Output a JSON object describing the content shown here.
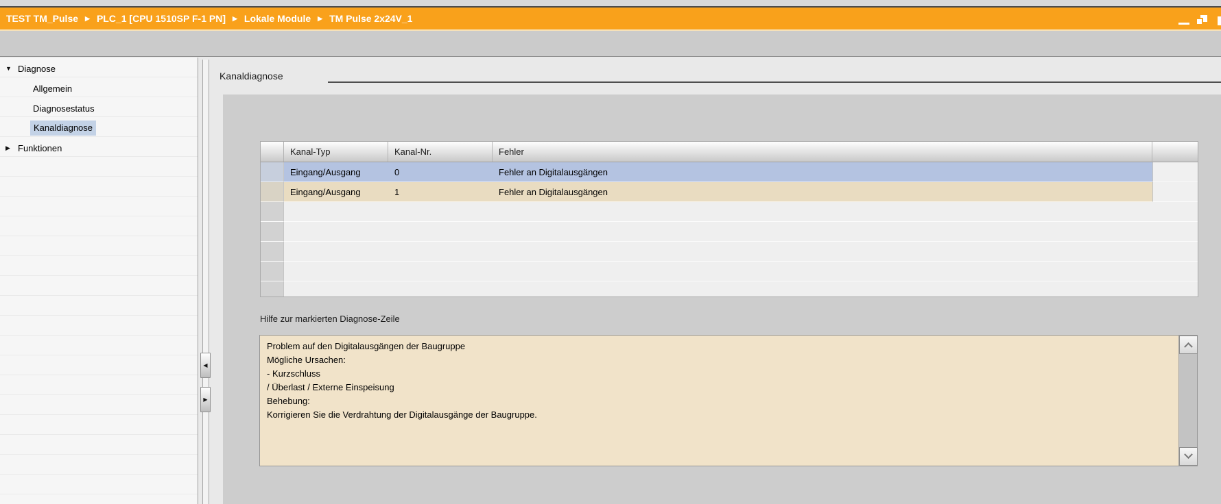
{
  "colors": {
    "accent_orange": "#F9A11B",
    "selected_row_blue": "#B4C3E1",
    "warning_row_tan": "#E9DCC1",
    "help_box_bg": "#F1E3C9",
    "tree_selection_blue": "#C3D2E6"
  },
  "title_bar": {
    "breadcrumbs": [
      "TEST TM_Pulse",
      "PLC_1 [CPU 1510SP F-1 PN]",
      "Lokale Module",
      "TM Pulse 2x24V_1"
    ],
    "window_controls": [
      "minimize",
      "restore",
      "clipped"
    ]
  },
  "sidebar": {
    "items": [
      {
        "label": "Diagnose",
        "arrow": "▼"
      },
      {
        "label": "Allgemein"
      },
      {
        "label": "Diagnosestatus"
      },
      {
        "label": "Kanaldiagnose",
        "selected": true
      },
      {
        "label": "Funktionen",
        "arrow": "▶"
      }
    ]
  },
  "main": {
    "heading": "Kanaldiagnose",
    "table": {
      "columns": [
        "Kanal-Typ",
        "Kanal-Nr.",
        "Fehler"
      ],
      "rows": [
        {
          "kanal_typ": "Eingang/Ausgang",
          "kanal_nr": "0",
          "fehler": "Fehler an Digitalausgängen",
          "state": "selected"
        },
        {
          "kanal_typ": "Eingang/Ausgang",
          "kanal_nr": "1",
          "fehler": "Fehler an Digitalausgängen",
          "state": "warning"
        }
      ]
    },
    "help": {
      "label": "Hilfe zur markierten Diagnose-Zeile",
      "lines": [
        "Problem auf den Digitalausgängen der Baugruppe",
        "Mögliche Ursachen:",
        " - Kurzschluss",
        " / Überlast / Externe Einspeisung",
        "Behebung:",
        "Korrigieren Sie die Verdrahtung der Digitalausgänge der Baugruppe."
      ]
    }
  }
}
